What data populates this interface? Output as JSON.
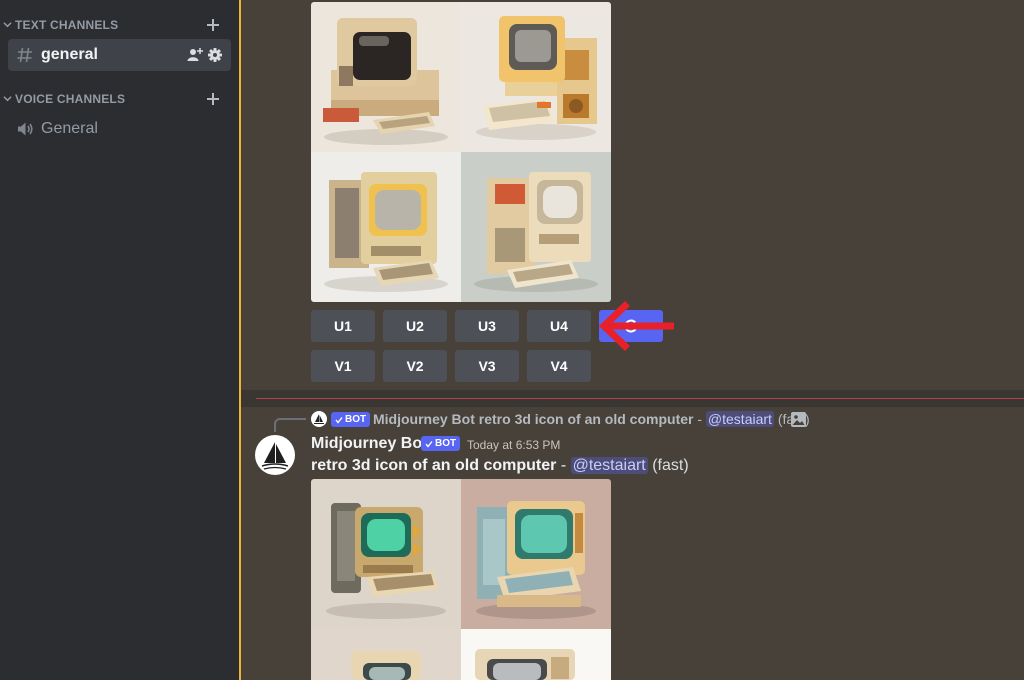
{
  "sidebar": {
    "text_category": "TEXT CHANNELS",
    "voice_category": "VOICE CHANNELS",
    "text_channels": [
      {
        "name": "general",
        "active": true
      }
    ],
    "voice_channels": [
      {
        "name": "General"
      }
    ]
  },
  "upscale_buttons": [
    "U1",
    "U2",
    "U3",
    "U4"
  ],
  "variation_buttons": [
    "V1",
    "V2",
    "V3",
    "V4"
  ],
  "reply": {
    "badge": "BOT",
    "author": "Midjourney Bot",
    "prompt": "retro 3d icon of an old computer",
    "separator": "-",
    "mention": "@testaiart",
    "speed": "(fast)"
  },
  "message": {
    "author": "Midjourney Bot",
    "badge": "BOT",
    "timestamp": "Today at 6:53 PM",
    "prompt": "retro 3d icon of an old computer",
    "separator": "-",
    "mention": "@testaiart",
    "speed": "(fast)"
  },
  "colors": {
    "accent": "#5865f2",
    "annotation_arrow": "#e8202a",
    "new_messages_line": "#d8485a",
    "channel_panel": "#2b2d31",
    "chat_background": "#474139"
  },
  "icons": [
    "hashtag-icon",
    "speaker-icon",
    "plus-icon",
    "chevron-down-icon",
    "add-member-icon",
    "gear-icon",
    "refresh-icon",
    "image-icon",
    "checkmark-icon",
    "sailboat-logo"
  ]
}
